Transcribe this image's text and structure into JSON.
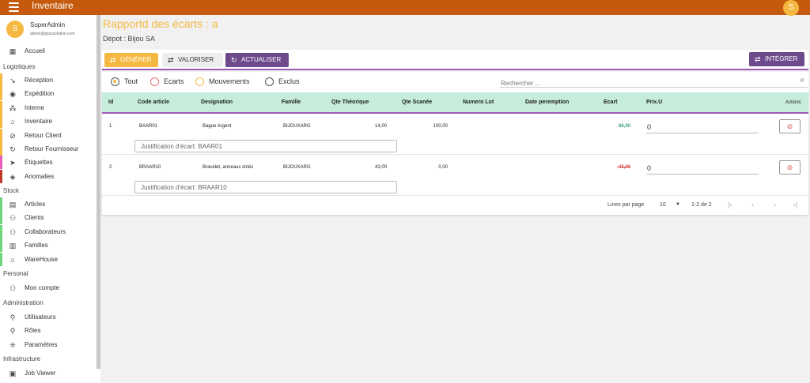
{
  "app": {
    "title": "Inventaire",
    "avatar_letter": "S"
  },
  "user": {
    "avatar_letter": "S",
    "name": "SuperAdmin",
    "email": "admin@gracsolution.com"
  },
  "sidebar": {
    "home": {
      "label": "Accueil",
      "icon": "grid-icon"
    },
    "sections": {
      "logistiques": "Logistiques",
      "stock": "Stock",
      "personal": "Personal",
      "administration": "Administration",
      "infrastructure": "Infrastructure"
    },
    "logistiques_items": [
      {
        "label": "Réception",
        "icon": "arrow-down-right-icon",
        "color": "#f5b942"
      },
      {
        "label": "Expédition",
        "icon": "compass-icon",
        "color": "#f5b942"
      },
      {
        "label": "Interne",
        "icon": "nodes-icon",
        "color": "#f5b942"
      },
      {
        "label": "Inventaire",
        "icon": "warehouse-icon",
        "color": "#f5b942"
      },
      {
        "label": "Retour Client",
        "icon": "return-icon",
        "color": "#f5b942"
      },
      {
        "label": "Retour Fournisseur",
        "icon": "refresh-icon",
        "color": "#f5b942"
      },
      {
        "label": "Étiquettes",
        "icon": "label-icon",
        "color": "#e85dba"
      },
      {
        "label": "Anomalies",
        "icon": "warning-diamond-icon",
        "color": "#c0392b"
      }
    ],
    "stock_items": [
      {
        "label": "Articles",
        "icon": "article-icon",
        "color": "#6ed67a"
      },
      {
        "label": "Clients",
        "icon": "people-icon",
        "color": "#6ed67a"
      },
      {
        "label": "Collaborateurs",
        "icon": "people-icon",
        "color": "#6ed67a"
      },
      {
        "label": "Familles",
        "icon": "document-icon",
        "color": "#6ed67a"
      },
      {
        "label": "WareHouse",
        "icon": "warehouse-icon",
        "color": "#6ed67a"
      }
    ],
    "personal_items": [
      {
        "label": "Mon compte",
        "icon": "people-icon"
      }
    ],
    "administration_items": [
      {
        "label": "Utilisateurs",
        "icon": "person-icon"
      },
      {
        "label": "Rôles",
        "icon": "person-icon"
      },
      {
        "label": "Paramètres",
        "icon": "settings-icon"
      }
    ],
    "infrastructure_items": [
      {
        "label": "Job Viewer",
        "icon": "briefcase-icon"
      }
    ]
  },
  "page": {
    "title": "Rapportd des écarts : a",
    "depot": "Dépot : Bijou SA"
  },
  "toolbar": {
    "generate": "GÉNÉRER",
    "valorize": "VALORISER",
    "refresh": "ACTUALISER",
    "integrate": "INTÉGRER"
  },
  "filters": {
    "options": [
      "Tout",
      "Ecarts",
      "Mouvements",
      "Exclus"
    ],
    "colors": [
      "#f5b942",
      "#e57373",
      "#f5b942",
      "#555555"
    ],
    "selected": "Tout"
  },
  "search": {
    "placeholder": "Rechercher ..."
  },
  "table": {
    "columns": [
      "Id",
      "Code article",
      "Designation",
      "Famille",
      "Qte Théorique",
      "Qte Scanée",
      "Numero Lot",
      "Date peremption",
      "Ecart",
      "Prix.U",
      "Actions"
    ],
    "rows": [
      {
        "id": "1",
        "code": "BAAR01",
        "designation": "Bague Argent",
        "famille": "BIJOUXARG",
        "qte_theorique": "14,00",
        "qte_scanee": "100,00",
        "numero_lot": "",
        "date_peremption": "",
        "ecart": "86,00",
        "prix": "0",
        "justification_placeholder": "Justification d'écart: BAAR01"
      },
      {
        "id": "2",
        "code": "BRAAR10",
        "designation": "Bracelet, anneaux striés",
        "famille": "BIJOUXARG",
        "qte_theorique": "43,00",
        "qte_scanee": "0,00",
        "numero_lot": "",
        "date_peremption": "",
        "ecart": "-43,00",
        "prix": "0",
        "justification_placeholder": "Justification d'écart: BRAAR10"
      }
    ]
  },
  "pager": {
    "lines_label": "Lines par page",
    "per_page": "10",
    "range": "1-2 de 2"
  },
  "colors": {
    "topbar": "#c55a0c",
    "accent": "#f5b942",
    "purple": "#6c4a8c",
    "header_bg": "#c6ecdc",
    "positive": "#3fa37a",
    "negative": "#d9534f"
  }
}
